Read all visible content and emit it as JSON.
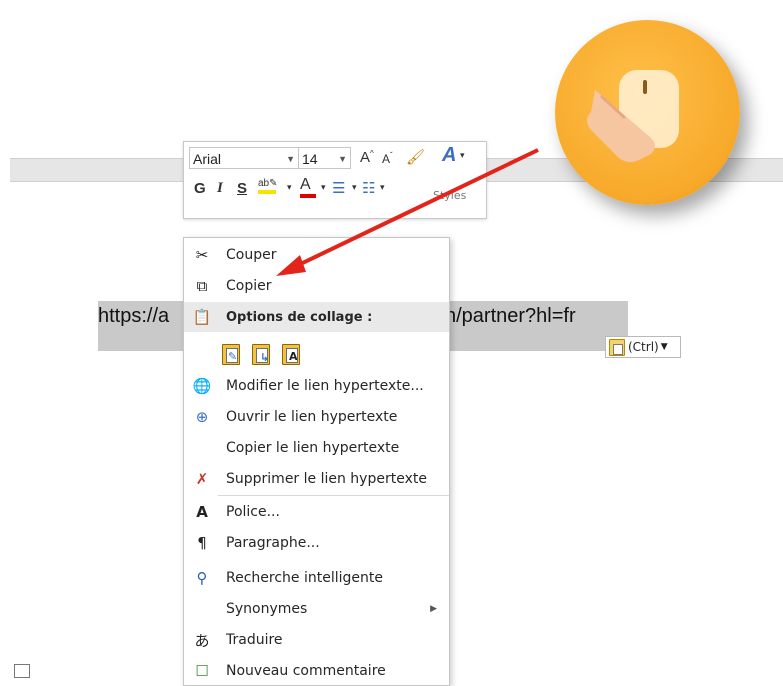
{
  "mini_toolbar": {
    "font_name": "Arial",
    "font_size": "14",
    "grow_font": "A",
    "shrink_font": "A",
    "bold": "G",
    "italic": "I",
    "underline": "S",
    "font_color": "A",
    "styles_label": "Styles",
    "highlight_color": "#f5e400",
    "font_color_bar": "#e00000"
  },
  "document": {
    "url_text_start": "https://a",
    "url_text_end": "n/partner?hl=fr",
    "paste_chip_label": "(Ctrl)"
  },
  "context_menu": {
    "items": [
      {
        "label": "Couper",
        "icon": "scissors-icon"
      },
      {
        "label": "Copier",
        "icon": "copy-icon"
      },
      {
        "label": "Options de collage :",
        "icon": "paste-icon"
      },
      {
        "label": "Modifier le lien hypertexte...",
        "icon": "edit-link-icon"
      },
      {
        "label": "Ouvrir le lien hypertexte",
        "icon": "open-link-icon"
      },
      {
        "label": "Copier le lien hypertexte",
        "icon": ""
      },
      {
        "label": "Supprimer le lien hypertexte",
        "icon": "remove-link-icon"
      },
      {
        "label": "Police...",
        "icon": "font-icon"
      },
      {
        "label": "Paragraphe...",
        "icon": "paragraph-icon"
      },
      {
        "label": "Recherche intelligente",
        "icon": "smart-lookup-icon"
      },
      {
        "label": "Synonymes",
        "icon": ""
      },
      {
        "label": "Traduire",
        "icon": "translate-icon"
      },
      {
        "label": "Nouveau commentaire",
        "icon": "comment-icon"
      }
    ]
  },
  "colors": {
    "arrow": "#e3241b",
    "circle": "#f7a92a",
    "selection": "#c9c9c9"
  }
}
